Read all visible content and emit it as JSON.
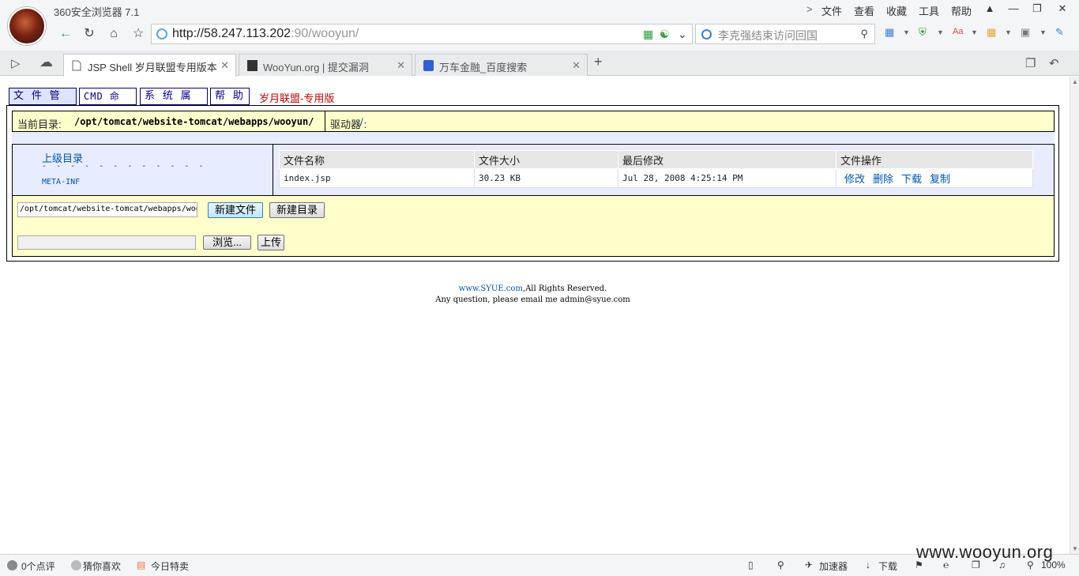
{
  "browser": {
    "title": "360安全浏览器 7.1",
    "menu": [
      "文件",
      "查看",
      "收藏",
      "工具",
      "帮助"
    ],
    "menu_chevron": ">",
    "url_host": "http://58.247.113.202",
    "url_rest": ":90/wooyun/",
    "search_text": "李克强结束访问回国",
    "tabs": [
      {
        "label": "JSP Shell 岁月联盟专用版本",
        "active": true
      },
      {
        "label": "WooYun.org | 提交漏洞",
        "active": false
      },
      {
        "label": "万车金融_百度搜索",
        "active": false
      }
    ],
    "new_tab": "+"
  },
  "shell": {
    "menu": [
      "文 件 管 理",
      "CMD 命 令",
      "系 统 属 性",
      "帮 助"
    ],
    "brand": "岁月联盟-专用版",
    "current_dir_label": "当前目录:",
    "current_dir": "/opt/tomcat/website-tomcat/webapps/wooyun/",
    "drive_label": "驱动器 :",
    "drive_value": "/",
    "parent_link": "上级目录",
    "dash": "- - - - - - - - - - - -",
    "folders": [
      "META-INF"
    ],
    "table": {
      "headers": [
        "文件名称",
        "文件大小",
        "最后修改",
        "文件操作"
      ],
      "rows": [
        {
          "name": "index.jsp",
          "size": "30.23 KB",
          "modified": "Jul 28, 2008 4:25:14 PM",
          "ops": [
            "修改",
            "删除",
            "下载",
            "复制"
          ]
        }
      ]
    },
    "path_input": "/opt/tomcat/website-tomcat/webapps/wooyun/",
    "new_file": "新建文件",
    "new_dir": "新建目录",
    "browse": "浏览...",
    "upload": "上传",
    "footer_link": "www.SYUE.com",
    "footer_rights": ",All Rights Reserved.",
    "footer_contact": "Any question, please email me admin@syue.com"
  },
  "statusbar": {
    "comments": "0个点评",
    "guess": "猜你喜欢",
    "deals": "今日特卖",
    "accelerator": "加速器",
    "download": "下载",
    "zoom": "100%"
  },
  "watermark": "www.wooyun.org"
}
